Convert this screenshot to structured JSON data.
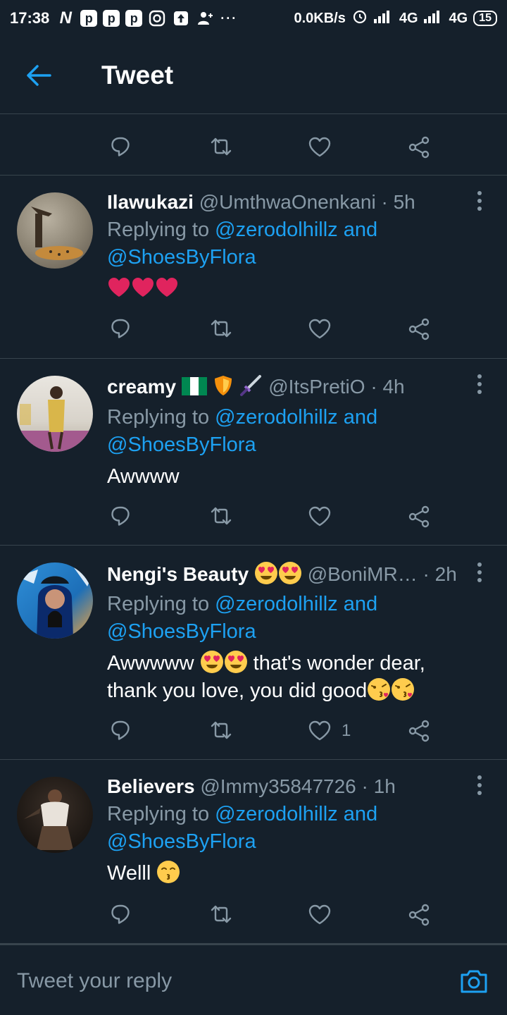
{
  "status_bar": {
    "time": "17:38",
    "speed": "0.0KB/s",
    "network1": "4G",
    "network2": "4G",
    "battery": "15"
  },
  "header": {
    "title": "Tweet"
  },
  "reply_prefix": "Replying to",
  "mention1": "@zerodolhillz",
  "and_word": "and",
  "mention2": "@ShoesByFlora",
  "tweets": [
    {
      "name": "Ilawukazi",
      "handle": "@UmthwaOnenkani",
      "time": "· 5h",
      "body": ""
    },
    {
      "name": "creamy",
      "handle": "@ItsPretiO",
      "time": "· 4h",
      "body": "Awwww"
    },
    {
      "name": "Nengi's Beauty",
      "handle": "@BoniMR…",
      "time": "· 2h",
      "body_line1": "Awwwww",
      "body_line1b": "that's wonder dear,",
      "body_line2": "thank you love, you did good",
      "likes": "1"
    },
    {
      "name": "Believers",
      "handle": "@Immy35847726",
      "time": "· 1h",
      "body": "Welll"
    }
  ],
  "reply_bar": {
    "placeholder": "Tweet your reply"
  },
  "colors": {
    "background": "#15202b",
    "accent": "#1da1f2",
    "muted": "#8899a6",
    "divider": "#38444d",
    "heart": "#e0245e"
  }
}
